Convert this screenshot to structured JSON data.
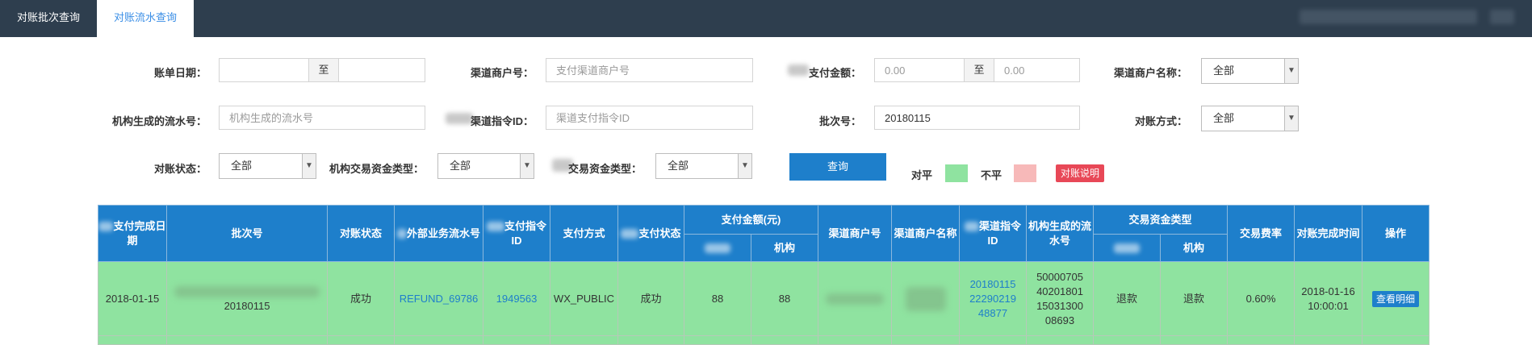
{
  "tabs": [
    {
      "label": "对账批次查询",
      "active": false
    },
    {
      "label": "对账流水查询",
      "active": true
    }
  ],
  "filters": {
    "bill_date": {
      "label": "账单日期：",
      "to": "至",
      "start": "",
      "end": ""
    },
    "channel_merchant_no": {
      "label": "渠道商户号：",
      "placeholder": "支付渠道商户号"
    },
    "pay_amount": {
      "label": "支付金额：",
      "to": "至",
      "min_placeholder": "0.00",
      "max_placeholder": "0.00"
    },
    "channel_merchant_name": {
      "label": "渠道商户名称：",
      "value": "全部"
    },
    "org_serial_no": {
      "label": "机构生成的流水号：",
      "placeholder": "机构生成的流水号"
    },
    "channel_cmd_id": {
      "label": "渠道指令ID：",
      "placeholder": "渠道支付指令ID"
    },
    "batch_no": {
      "label": "批次号：",
      "value": "20180115"
    },
    "recon_method": {
      "label": "对账方式：",
      "value": "全部"
    },
    "recon_status": {
      "label": "对账状态：",
      "value": "全部"
    },
    "org_fund_type": {
      "label": "机构交易资金类型：",
      "value": "全部"
    },
    "fund_type": {
      "label": "交易资金类型：",
      "value": "全部"
    }
  },
  "actions": {
    "query": "查询",
    "explain": "对账说明"
  },
  "legend": {
    "match_label": "对平",
    "match_color": "#8fe3a0",
    "mismatch_label": "不平",
    "mismatch_color": "#f7b9b9"
  },
  "table": {
    "headers": {
      "pay_done_date": "支付完成日期",
      "batch_no": "批次号",
      "recon_status": "对账状态",
      "ext_serial": "外部业务流水号",
      "pay_cmd_id": "支付指令ID",
      "pay_method": "支付方式",
      "pay_status": "支付状态",
      "pay_amount": "支付金额(元)",
      "pay_amount_org": "机构",
      "channel_merchant_no": "渠道商户号",
      "channel_merchant_name": "渠道商户名称",
      "channel_cmd_id": "渠道指令ID",
      "org_serial": "机构生成的流水号",
      "fund_type": "交易资金类型",
      "fund_type_org": "机构",
      "fee_rate": "交易费率",
      "recon_done_time": "对账完成时间",
      "op": "操作"
    },
    "rows": [
      {
        "pay_done_date": "2018-01-15",
        "batch_no": "20180115",
        "recon_status": "成功",
        "ext_serial": "REFUND_69786",
        "pay_cmd_id": "1949563",
        "pay_method": "WX_PUBLIC",
        "pay_status": "成功",
        "amount_a": "88",
        "amount_org": "88",
        "channel_cmd_id": "2018011522290219 48877",
        "org_serial": "5000070540201801 1503130008693",
        "fund_type_a": "退款",
        "fund_type_org": "退款",
        "fee_rate": "0.60%",
        "recon_done_time": "2018-01-16 10:00:01",
        "op": "查看明细"
      }
    ]
  }
}
